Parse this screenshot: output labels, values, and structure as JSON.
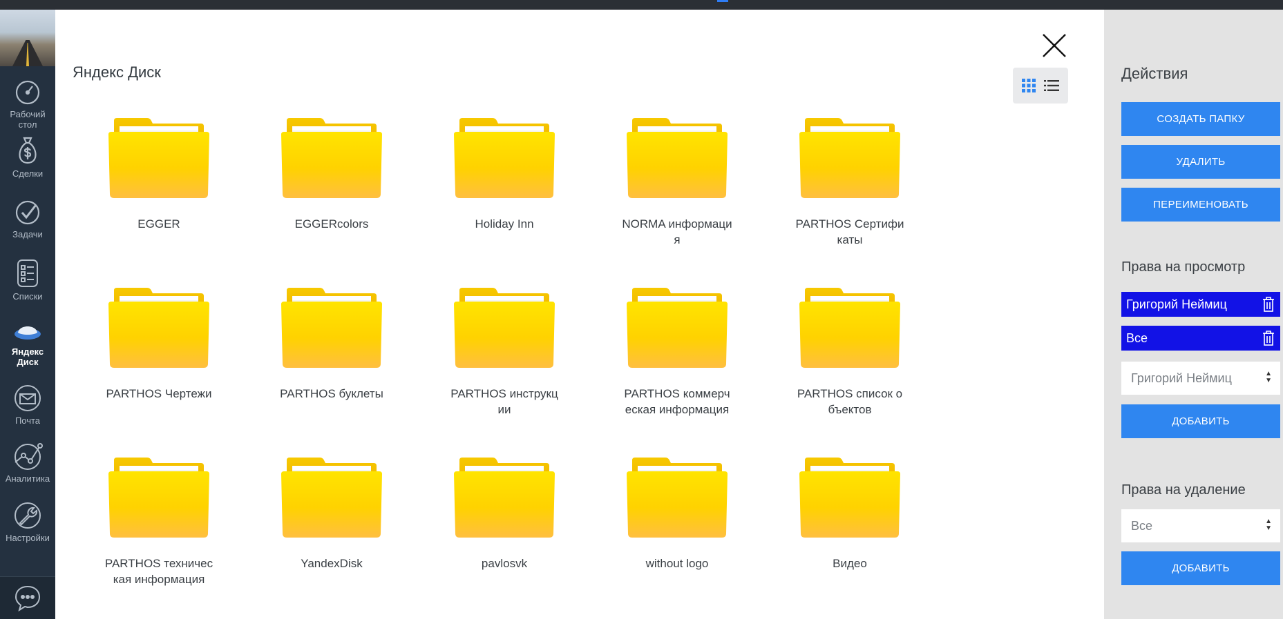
{
  "sidebar": {
    "items": [
      {
        "label": "Рабочий стол",
        "icon": "gauge-icon"
      },
      {
        "label": "Сделки",
        "icon": "dollar-bag-icon"
      },
      {
        "label": "Задачи",
        "icon": "check-circle-icon"
      },
      {
        "label": "Списки",
        "icon": "list-icon"
      },
      {
        "label": "Яндекс Диск",
        "icon": "yandex-disk-icon",
        "active": true
      },
      {
        "label": "Почта",
        "icon": "mail-icon"
      },
      {
        "label": "Аналитика",
        "icon": "analytics-icon"
      },
      {
        "label": "Настройки",
        "icon": "wrench-icon"
      }
    ],
    "bottom_icon": "chat-icon"
  },
  "main": {
    "title": "Яндекс Диск",
    "view_modes": [
      "grid-view-icon",
      "list-view-icon"
    ],
    "active_view": "grid",
    "folders": [
      "EGGER",
      "EGGERcolors",
      "Holiday Inn",
      "NORMA информация",
      "PARTHOS Сертификаты",
      "PARTHOS Чертежи",
      "PARTHOS буклеты",
      "PARTHOS инструкции",
      "PARTHOS коммерческая информация",
      "PARTHOS список объектов",
      "PARTHOS техническая информация",
      "YandexDisk",
      "pavlosvk",
      "without logo",
      "Видео"
    ]
  },
  "panel": {
    "actions_title": "Действия",
    "create_folder": "СОЗДАТЬ ПАПКУ",
    "delete": "УДАЛИТЬ",
    "rename": "ПЕРЕИМЕНОВАТЬ",
    "view_rights_title": "Права на просмотр",
    "view_rights_users": [
      "Григорий Неймиц",
      "Все"
    ],
    "view_rights_select": "Григорий Неймиц",
    "view_rights_add": "ДОБАВИТЬ",
    "delete_rights_title": "Права на удаление",
    "delete_rights_select": "Все",
    "delete_rights_add": "ДОБАВИТЬ"
  },
  "colors": {
    "sidebar_bg": "#243140",
    "panel_bg": "#e3e3e3",
    "button_blue": "#2f86f0",
    "tag_blue": "#1212e6",
    "folder_yellow": "#ffd400"
  }
}
